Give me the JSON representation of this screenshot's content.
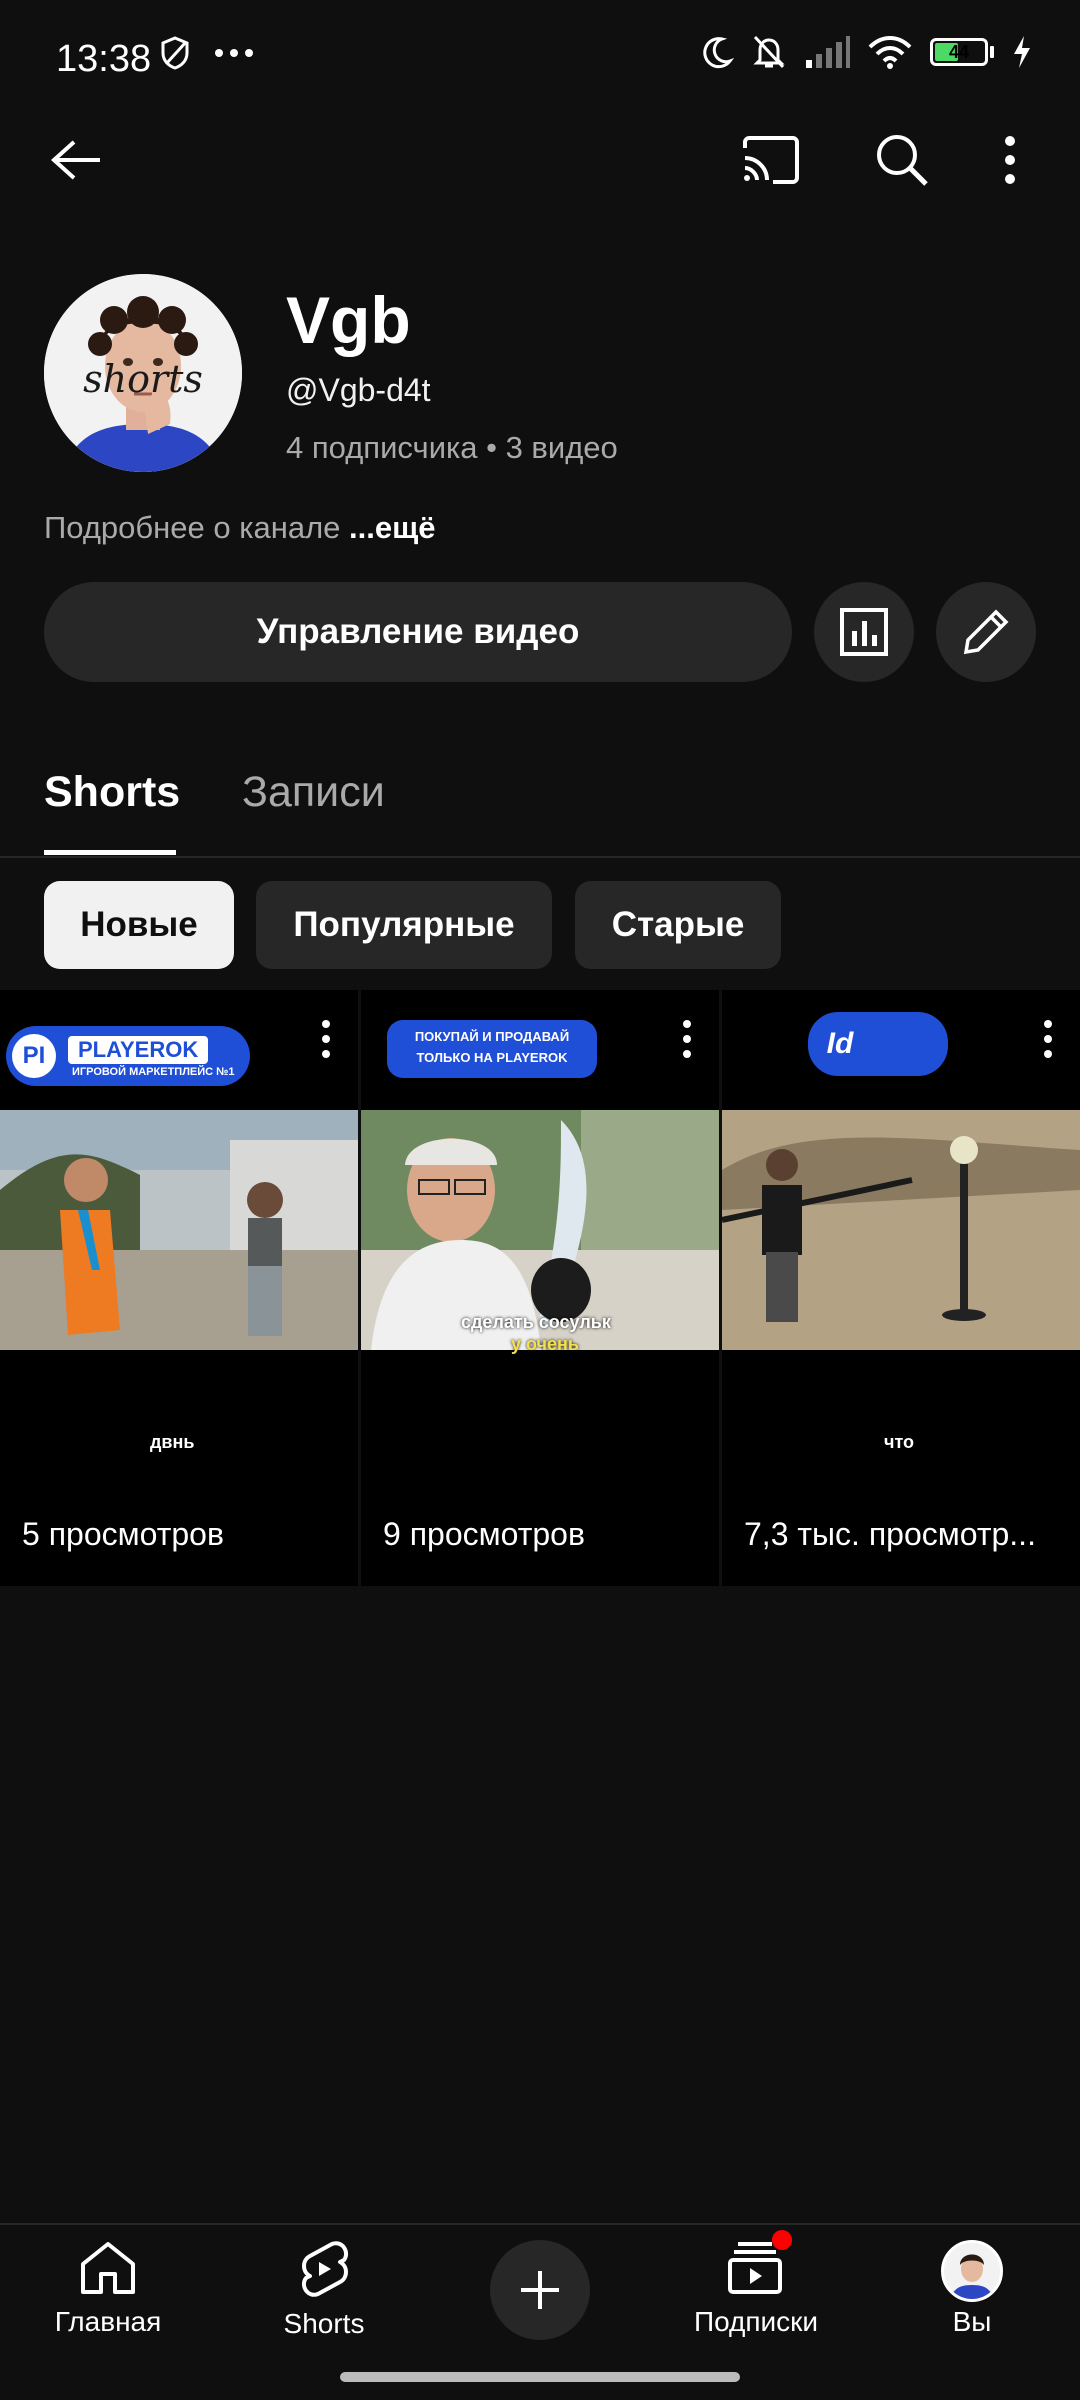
{
  "status_bar": {
    "time": "13:38",
    "battery": "44",
    "icons": [
      "mute-shield-icon",
      "more-dots-icon",
      "moon-icon",
      "bell-off-icon",
      "signal-icon",
      "wifi-icon",
      "battery-icon",
      "charging-icon"
    ]
  },
  "top_bar": {
    "icons": [
      "back-arrow-icon",
      "cast-icon",
      "search-icon",
      "overflow-menu-icon"
    ]
  },
  "channel": {
    "name": "Vgb",
    "handle": "@Vgb-d4t",
    "stats": "4 подписчика • 3 видео",
    "about": "Подробнее о канале",
    "about_more": "...ещё",
    "avatar_text": "shorts"
  },
  "actions": {
    "manage_label": "Управление видео",
    "icons": [
      "analytics-icon",
      "edit-pencil-icon"
    ]
  },
  "tabs": [
    {
      "label": "Shorts",
      "active": true
    },
    {
      "label": "Записи",
      "active": false
    }
  ],
  "chips": [
    {
      "label": "Новые",
      "selected": true
    },
    {
      "label": "Популярные",
      "selected": false
    },
    {
      "label": "Старые",
      "selected": false
    }
  ],
  "shorts": [
    {
      "views": "5 просмотров",
      "banner_title": "PLAYEROK",
      "banner_sub": "ИГРОВОЙ МАРКЕТПЛЕЙС №1",
      "caption": "двнь"
    },
    {
      "views": "9 просмотров",
      "banner_line1": "ПОКУПАЙ И ПРОДАВАЙ",
      "banner_line2": "ТОЛЬКО НА PLAYEROK",
      "caption_line1": "сделать сосульк",
      "caption_line2": "у очень"
    },
    {
      "views": "7,3 тыс. просмотр...",
      "banner_title": "Id",
      "caption": "что"
    }
  ],
  "bottom_nav": [
    {
      "label": "Главная",
      "icon": "home-icon"
    },
    {
      "label": "Shorts",
      "icon": "shorts-icon"
    },
    {
      "label": "",
      "icon": "create-plus-icon"
    },
    {
      "label": "Подписки",
      "icon": "subscriptions-icon"
    },
    {
      "label": "Вы",
      "icon": "profile-avatar-icon"
    }
  ],
  "colors": {
    "background": "#0f0f0f",
    "surface": "#272727",
    "secondary_text": "#aaaaaa",
    "notification": "#ff0000",
    "brand_blue": "#1f4fd6"
  }
}
